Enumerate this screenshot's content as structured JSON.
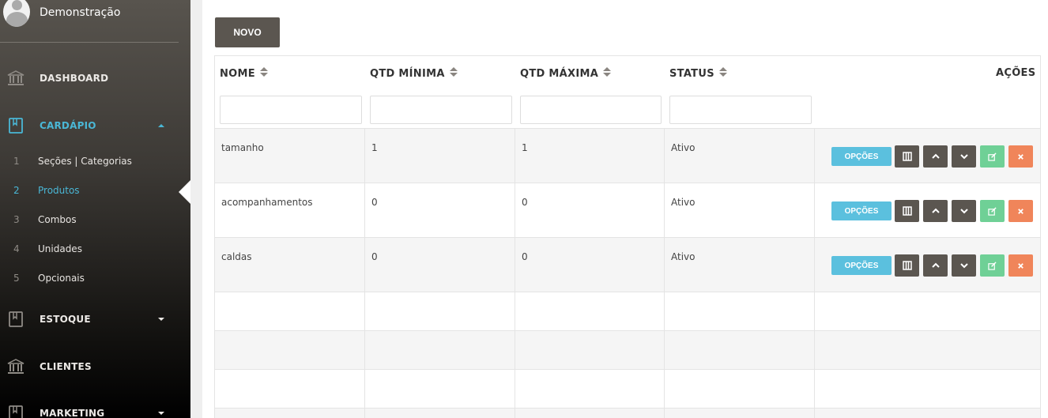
{
  "user": {
    "name": "Demonstração"
  },
  "menu": {
    "dashboard": "DASHBOARD",
    "cardapio": "CARDÁPIO",
    "estoque": "ESTOQUE",
    "clientes": "CLIENTES",
    "marketing": "MARKETING"
  },
  "submenu": [
    {
      "num": "1",
      "label": "Seções | Categorias"
    },
    {
      "num": "2",
      "label": "Produtos"
    },
    {
      "num": "3",
      "label": "Combos"
    },
    {
      "num": "4",
      "label": "Unidades"
    },
    {
      "num": "5",
      "label": "Opcionais"
    }
  ],
  "toolbar": {
    "novo_label": "NOVO"
  },
  "table": {
    "headers": {
      "nome": "NOME",
      "qtd_min": "QTD MÍNIMA",
      "qtd_max": "QTD MÁXIMA",
      "status": "STATUS",
      "acoes": "AÇÕES"
    },
    "rows": [
      {
        "nome": "tamanho",
        "qtd_min": "1",
        "qtd_max": "1",
        "status": "Ativo"
      },
      {
        "nome": "acompanhamentos",
        "qtd_min": "0",
        "qtd_max": "0",
        "status": "Ativo"
      },
      {
        "nome": "caldas",
        "qtd_min": "0",
        "qtd_max": "0",
        "status": "Ativo"
      }
    ],
    "opcoes_label": "OPÇÕES"
  },
  "colors": {
    "accent": "#4ab7d6",
    "dark_button": "#5b5650",
    "edit": "#6fd096",
    "delete": "#f0855a",
    "info": "#5bc0de"
  }
}
